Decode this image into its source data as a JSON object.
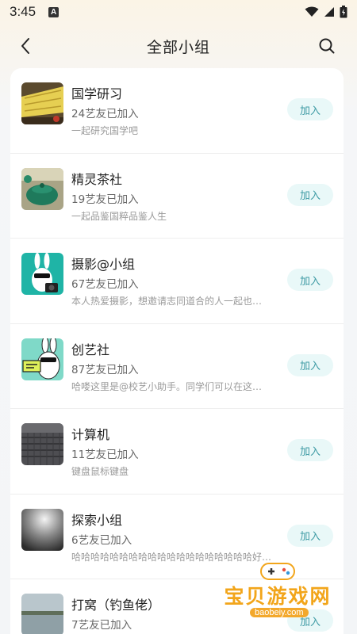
{
  "status_bar": {
    "time": "3:45",
    "notification_icon": "A"
  },
  "header": {
    "title": "全部小组"
  },
  "groups": [
    {
      "name": "国学研习",
      "members": "24艺友已加入",
      "desc": "一起研究国学吧",
      "join_label": "加入"
    },
    {
      "name": "精灵茶社",
      "members": "19艺友已加入",
      "desc": "一起品鉴国粹品鉴人生",
      "join_label": "加入"
    },
    {
      "name": "摄影@小组",
      "members": "67艺友已加入",
      "desc": "本人热爱摄影，想邀请志同道合的人一起也…",
      "join_label": "加入"
    },
    {
      "name": "创艺社",
      "members": "87艺友已加入",
      "desc": "哈喽这里是@校艺小助手。同学们可以在这…",
      "join_label": "加入"
    },
    {
      "name": "计算机",
      "members": "11艺友已加入",
      "desc": "键盘鼠标键盘",
      "join_label": "加入"
    },
    {
      "name": "探索小组",
      "members": "6艺友已加入",
      "desc": "哈哈哈哈哈哈哈哈哈哈哈哈哈哈哈哈哈哈哈好…",
      "join_label": "加入"
    },
    {
      "name": "打窝（钓鱼佬）",
      "members": "7艺友已加入",
      "desc": "",
      "join_label": "加入"
    }
  ],
  "watermark": {
    "text": "宝贝游戏网",
    "url": "baobeiy.com"
  }
}
